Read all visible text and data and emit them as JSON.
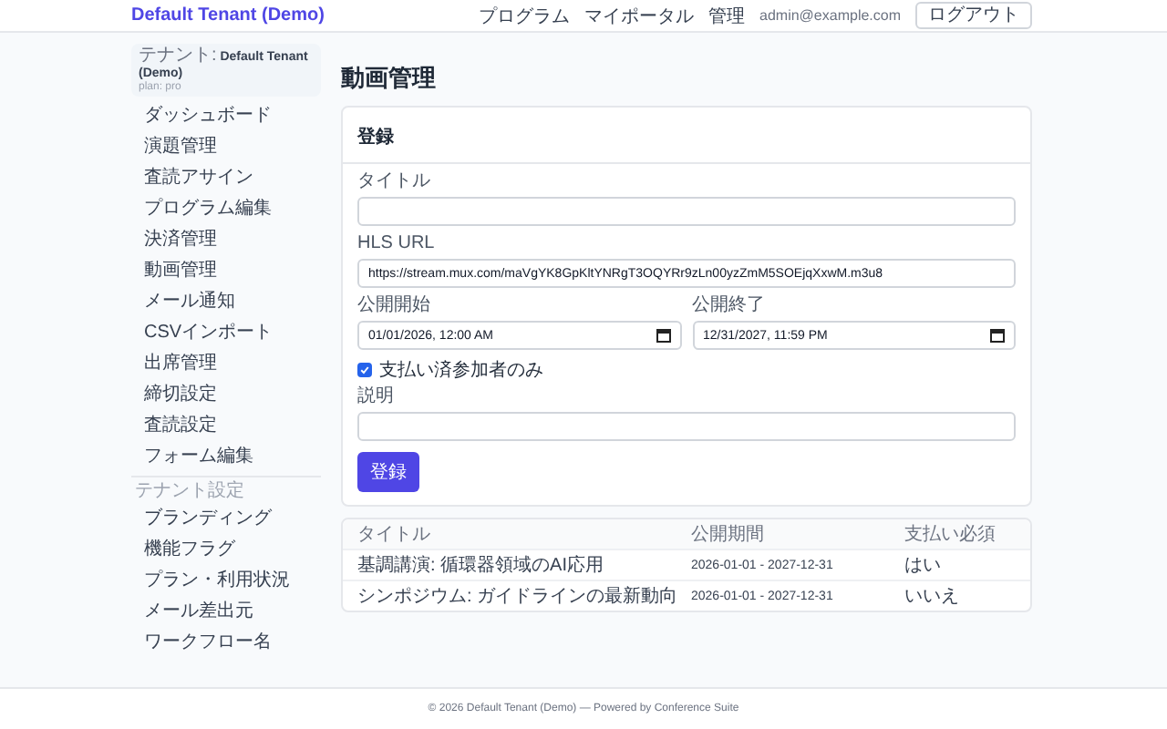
{
  "header": {
    "brand": "Default Tenant (Demo)",
    "nav": [
      "プログラム",
      "マイポータル",
      "管理"
    ],
    "user_email": "admin@example.com",
    "logout": "ログアウト"
  },
  "sidebar": {
    "tenant_label": "テナント:",
    "tenant_name": "Default Tenant (Demo)",
    "plan": "plan: pro",
    "items": [
      "ダッシュボード",
      "演題管理",
      "査読アサイン",
      "プログラム編集",
      "決済管理",
      "動画管理",
      "メール通知",
      "CSVインポート",
      "出席管理",
      "締切設定",
      "査読設定",
      "フォーム編集"
    ],
    "section_label": "テナント設定",
    "settings_items": [
      "ブランディング",
      "機能フラグ",
      "プラン・利用状況",
      "メール差出元",
      "ワークフロー名"
    ]
  },
  "page_title": "動画管理",
  "form": {
    "title": "登録",
    "title_field": {
      "label": "タイトル"
    },
    "hls_url": {
      "label": "HLS URL",
      "value": "https://stream.mux.com/maVgYK8GpKltYNRgT3OQYRr9zLn00yzZmM5SOEjqXxwM.m3u8"
    },
    "publish_start": {
      "label": "公開開始",
      "value": "01/01/2026, 12:00 AM"
    },
    "publish_end": {
      "label": "公開終了",
      "value": "12/31/2027, 11:59 PM"
    },
    "paid_only": {
      "label": "支払い済参加者のみ",
      "checked": true
    },
    "description": {
      "label": "説明"
    },
    "submit": "登録"
  },
  "table": {
    "columns": [
      "タイトル",
      "公開期間",
      "支払い必須"
    ],
    "rows": [
      {
        "title": "基調講演: 循環器領域のAI応用",
        "period": "2026-01-01 - 2027-12-31",
        "paid_required": "はい"
      },
      {
        "title": "シンポジウム: ガイドラインの最新動向",
        "period": "2026-01-01 - 2027-12-31",
        "paid_required": "いいえ"
      }
    ]
  },
  "footer": "© 2026 Default Tenant (Demo) — Powered by Conference Suite"
}
